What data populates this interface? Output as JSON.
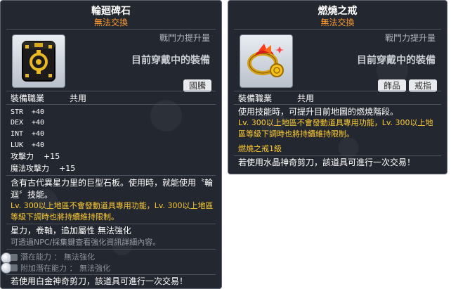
{
  "left": {
    "title": "輪廻碑石",
    "trade": "無法交換",
    "gauge_label": "戰鬥力提升量",
    "equip_label": "目前穿戴中的裝備",
    "tags": [
      "國騰"
    ],
    "job_label": "裝備職業",
    "job_value": "共用",
    "stats": [
      {
        "name": "STR",
        "value": "+40"
      },
      {
        "name": "DEX",
        "value": "+40"
      },
      {
        "name": "INT",
        "value": "+40"
      },
      {
        "name": "LUK",
        "value": "+40"
      }
    ],
    "atk": {
      "name": "攻擊力",
      "value": "+15"
    },
    "matk": {
      "name": "魔法攻擊力",
      "value": "+15"
    },
    "desc1": "含有古代異星力里的巨型石板。使用時，就能使用〝輪迴〞技能。",
    "desc_yellow": "Lv. 300以上地區不會發動道具專用功能，Lv. 300以上地區等級下調時也將持續維持限制。",
    "flags": "星力，卷軸，追加屬性 無法強化",
    "hint": "可透過NPC/採集鍵查看強化資訊詳細內容。",
    "potential": "潛在能力 ： 無法強化",
    "additional_potential": "附加潛在能力 ： 無法強化",
    "footer": "若使用白金神奇剪刀，該道具可進行一次交易！"
  },
  "right": {
    "title": "燃燒之戒",
    "trade": "無法交換",
    "gauge_label": "戰鬥力提升量",
    "equip_label": "目前穿戴中的裝備",
    "tags": [
      "飾品",
      "戒指"
    ],
    "job_label": "裝備職業",
    "job_value": "共用",
    "desc1": "使用技能時，可提升目前地圖的燃燒階段。",
    "desc_yellow": "Lv. 300以上地區不會發動道具專用功能，Lv. 300以上地區等級下調時也將持續維持限制。",
    "level": "燃燒之戒1級",
    "footer": "若使用水晶神奇剪刀，該道具可進行一次交易！"
  },
  "colors": {
    "title": "#ffffff",
    "trade": "#ff9a2e",
    "highlight": "#ffcc33",
    "panel": "#1a1e26"
  }
}
